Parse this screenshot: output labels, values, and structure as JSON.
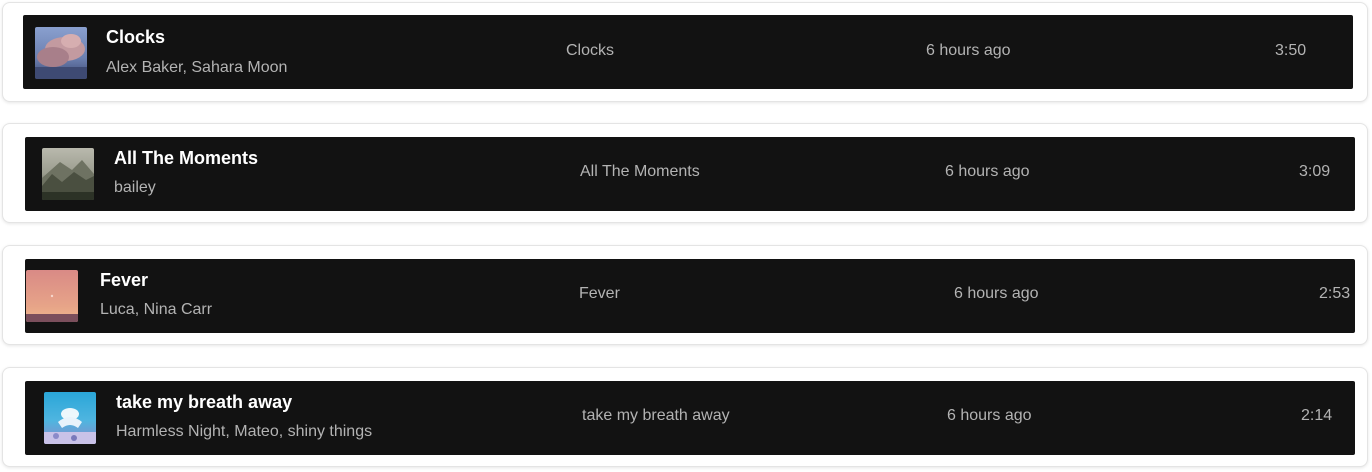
{
  "tracks": [
    {
      "title": "Clocks",
      "artists": "Alex Baker, Sahara Moon",
      "album": "Clocks",
      "added": "6 hours ago",
      "duration": "3:50",
      "cover_icon": "cloud-sky-cover-art",
      "cover_colors": [
        "#6b7fb0",
        "#c39aa0",
        "#3e4a73"
      ]
    },
    {
      "title": "All The Moments",
      "artists": "bailey",
      "album": "All The Moments",
      "added": "6 hours ago",
      "duration": "3:09",
      "cover_icon": "misty-forest-cover-art",
      "cover_colors": [
        "#9a9c8e",
        "#4a4f40",
        "#2c3226"
      ]
    },
    {
      "title": "Fever",
      "artists": "Luca, Nina Carr",
      "album": "Fever",
      "added": "6 hours ago",
      "duration": "2:53",
      "cover_icon": "sunset-gradient-cover-art",
      "cover_colors": [
        "#d98a86",
        "#e7a488",
        "#7b4f5c"
      ]
    },
    {
      "title": "take my breath away",
      "artists": "Harmless Night, Mateo, shiny things",
      "album": "take my breath away",
      "added": "6 hours ago",
      "duration": "2:14",
      "cover_icon": "underwater-figure-cover-art",
      "cover_colors": [
        "#2aa6d8",
        "#ffffff",
        "#8b8ac9"
      ]
    }
  ],
  "colors": {
    "row_background": "#121212",
    "title_text": "#ffffff",
    "secondary_text": "#b3b3b3",
    "card_background": "#ffffff"
  }
}
